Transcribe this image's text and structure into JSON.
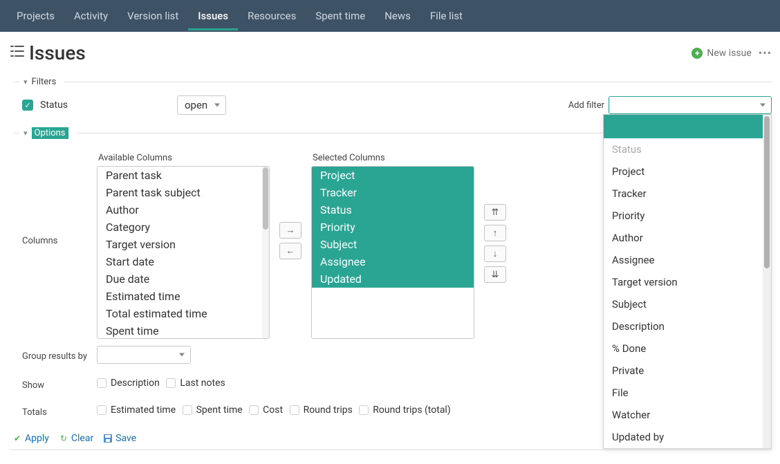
{
  "nav": {
    "items": [
      {
        "label": "Projects"
      },
      {
        "label": "Activity"
      },
      {
        "label": "Version list"
      },
      {
        "label": "Issues",
        "active": true
      },
      {
        "label": "Resources"
      },
      {
        "label": "Spent time"
      },
      {
        "label": "News"
      },
      {
        "label": "File list"
      }
    ]
  },
  "header": {
    "title": "Issues",
    "new_issue": "New issue"
  },
  "filters": {
    "legend": "Filters",
    "status_label": "Status",
    "status_value": "open",
    "add_filter_label": "Add filter",
    "dropdown": [
      {
        "label": "",
        "blank": true
      },
      {
        "label": "Status",
        "disabled": true
      },
      {
        "label": "Project"
      },
      {
        "label": "Tracker"
      },
      {
        "label": "Priority"
      },
      {
        "label": "Author"
      },
      {
        "label": "Assignee"
      },
      {
        "label": "Target version"
      },
      {
        "label": "Subject"
      },
      {
        "label": "Description"
      },
      {
        "label": "% Done"
      },
      {
        "label": "Private"
      },
      {
        "label": "File"
      },
      {
        "label": "Watcher"
      },
      {
        "label": "Updated by"
      }
    ]
  },
  "options": {
    "legend": "Options",
    "columns_label": "Columns",
    "available_header": "Available Columns",
    "selected_header": "Selected Columns",
    "available": [
      "Parent task",
      "Parent task subject",
      "Author",
      "Category",
      "Target version",
      "Start date",
      "Due date",
      "Estimated time",
      "Total estimated time",
      "Spent time"
    ],
    "selected": [
      "Project",
      "Tracker",
      "Status",
      "Priority",
      "Subject",
      "Assignee",
      "Updated"
    ],
    "btn_right": "→",
    "btn_left": "←",
    "btn_top": "⇈",
    "btn_up": "↑",
    "btn_down": "↓",
    "btn_bottom": "⇊",
    "group_label": "Group results by",
    "show_label": "Show",
    "show_opts": [
      "Description",
      "Last notes"
    ],
    "totals_label": "Totals",
    "totals_opts": [
      "Estimated time",
      "Spent time",
      "Cost",
      "Round trips",
      "Round trips (total)"
    ]
  },
  "actions": {
    "apply": "Apply",
    "clear": "Clear",
    "save": "Save"
  }
}
